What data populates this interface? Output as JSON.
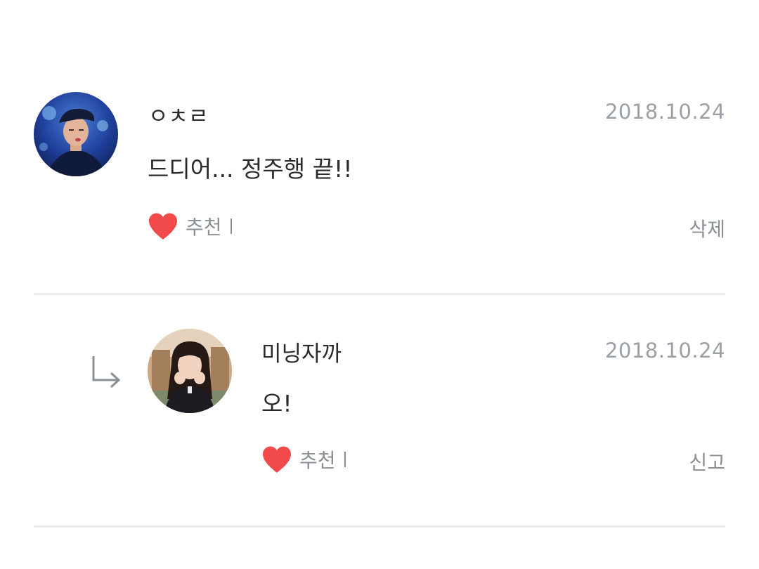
{
  "comments": [
    {
      "author": "ㅇㅊㄹ",
      "date": "2018.10.24",
      "text": "드디어... 정주행 끝!!",
      "recommend_label": "추천",
      "action_label": "삭제",
      "avatar_icon": "user-avatar-icon"
    },
    {
      "author": "미닝자까",
      "date": "2018.10.24",
      "text": "오!",
      "recommend_label": "추천",
      "action_label": "신고",
      "avatar_icon": "user-avatar-icon",
      "is_reply": true
    }
  ],
  "colors": {
    "heart": "#f24a4a",
    "muted_text": "#8a8f95",
    "date": "#9aa0a6",
    "divider": "#e8ecef"
  }
}
